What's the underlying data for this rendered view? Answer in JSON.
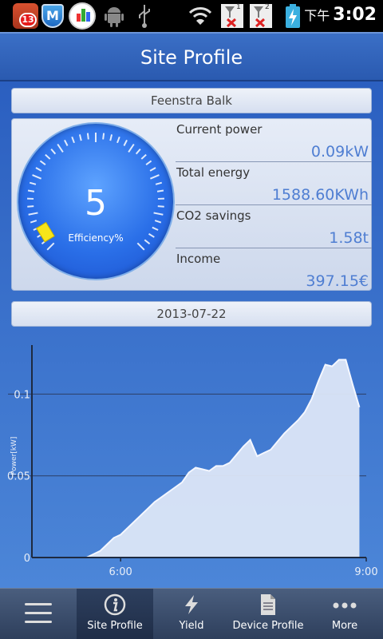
{
  "status_bar": {
    "notification_count": "13",
    "time_prefix": "下午",
    "time": "3:02",
    "sim1": "1",
    "sim2": "2"
  },
  "header": {
    "title": "Site Profile"
  },
  "site": {
    "name": "Feenstra Balk"
  },
  "gauge": {
    "value": "5",
    "label": "Efficiency%"
  },
  "stats": [
    {
      "label": "Current power",
      "value": "0.09kW"
    },
    {
      "label": "Total energy",
      "value": "1588.60KWh"
    },
    {
      "label": "CO2 savings",
      "value": "1.58t"
    },
    {
      "label": "Income",
      "value": "397.15€"
    }
  ],
  "date": "2013-07-22",
  "chart_data": {
    "type": "area",
    "ylabel": "Power[kW]",
    "y_ticks": [
      "0.1",
      "0.05",
      "0"
    ],
    "x_ticks": [
      "6:00",
      "9:00"
    ],
    "ylim": [
      0,
      0.13
    ],
    "x_range": [
      "4:55",
      "9:00"
    ],
    "x": [
      "5:35",
      "5:40",
      "5:45",
      "5:50",
      "5:55",
      "6:00",
      "6:05",
      "6:10",
      "6:15",
      "6:20",
      "6:25",
      "6:30",
      "6:35",
      "6:40",
      "6:45",
      "6:50",
      "6:55",
      "7:00",
      "7:05",
      "7:10",
      "7:15",
      "7:20",
      "7:25",
      "7:30",
      "7:35",
      "7:40",
      "7:45",
      "7:50",
      "7:55",
      "8:00",
      "8:05",
      "8:10",
      "8:15",
      "8:20",
      "8:25",
      "8:30",
      "8:35",
      "8:40",
      "8:45",
      "8:50",
      "8:55"
    ],
    "values": [
      0,
      0.002,
      0.004,
      0.008,
      0.012,
      0.014,
      0.018,
      0.022,
      0.026,
      0.03,
      0.034,
      0.037,
      0.04,
      0.043,
      0.046,
      0.052,
      0.055,
      0.054,
      0.053,
      0.056,
      0.056,
      0.058,
      0.063,
      0.068,
      0.072,
      0.062,
      0.064,
      0.066,
      0.071,
      0.076,
      0.08,
      0.084,
      0.089,
      0.097,
      0.108,
      0.118,
      0.117,
      0.121,
      0.121,
      0.106,
      0.092
    ],
    "colors": {
      "fill": "#dce6f7",
      "line": "#f4f7ff",
      "axis": "#1e2a40",
      "grid": "#2c3f66",
      "text": "#e8eef8"
    }
  },
  "nav": [
    {
      "label": "",
      "icon": "menu-icon"
    },
    {
      "label": "Site Profile",
      "icon": "info-icon"
    },
    {
      "label": "Yield",
      "icon": "lightning-icon"
    },
    {
      "label": "Device Profile",
      "icon": "document-icon"
    },
    {
      "label": "More",
      "icon": "more-icon"
    }
  ]
}
